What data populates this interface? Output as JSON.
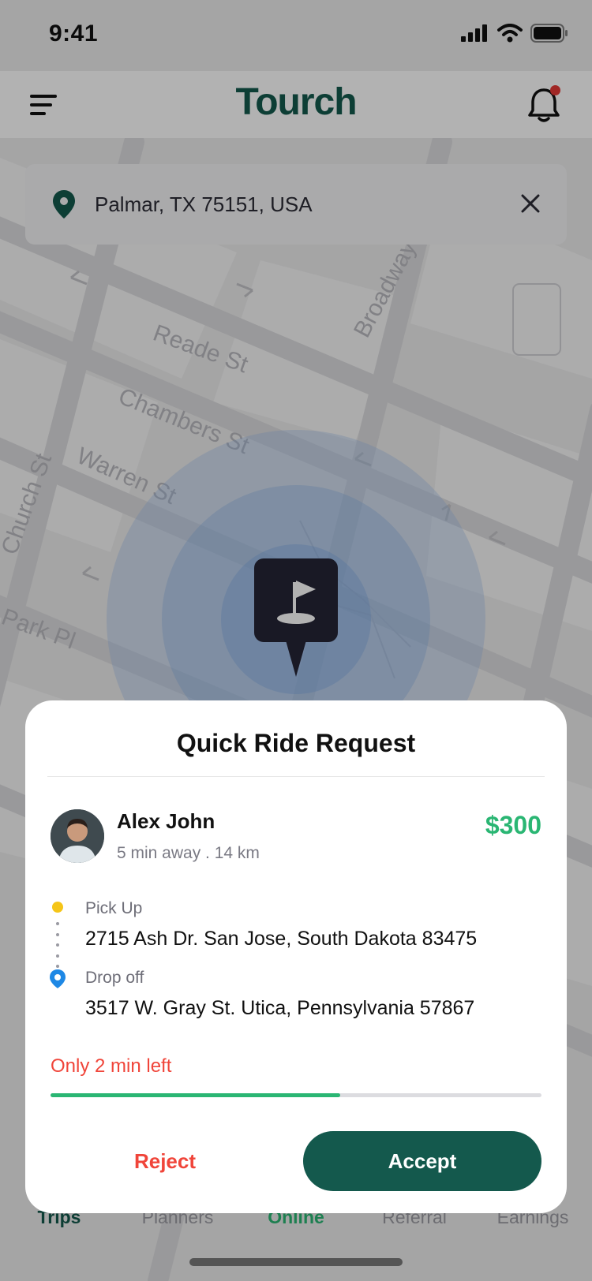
{
  "status_bar": {
    "time": "9:41"
  },
  "header": {
    "app_name": "Tourch",
    "notification_dot": true
  },
  "search": {
    "location": "Palmar, TX 75151, USA"
  },
  "map": {
    "streets": [
      "Reade St",
      "Chambers St",
      "Warren St",
      "Church St",
      "Park Pl",
      "Broadway"
    ]
  },
  "ride_request": {
    "title": "Quick Ride Request",
    "rider": {
      "name": "Alex John",
      "meta": "5 min away . 14 km"
    },
    "fare": "$300",
    "pickup": {
      "label": "Pick Up",
      "address": "2715 Ash Dr. San Jose, South Dakota 83475"
    },
    "dropoff": {
      "label": "Drop off",
      "address": "3517 W. Gray St. Utica, Pennsylvania 57867"
    },
    "timer_text": "Only 2 min left",
    "time_progress": 0.59,
    "reject_label": "Reject",
    "accept_label": "Accept"
  },
  "bottom_nav": {
    "items": [
      {
        "label": "Trips"
      },
      {
        "label": "Planners"
      },
      {
        "label": "Online"
      },
      {
        "label": "Referral"
      },
      {
        "label": "Earnings"
      }
    ]
  },
  "colors": {
    "brand": "#14594d",
    "accent_green": "#2ab673",
    "warning_red": "#f0453a",
    "pickup_yellow": "#f5c518",
    "dropoff_blue": "#1e88e5"
  }
}
